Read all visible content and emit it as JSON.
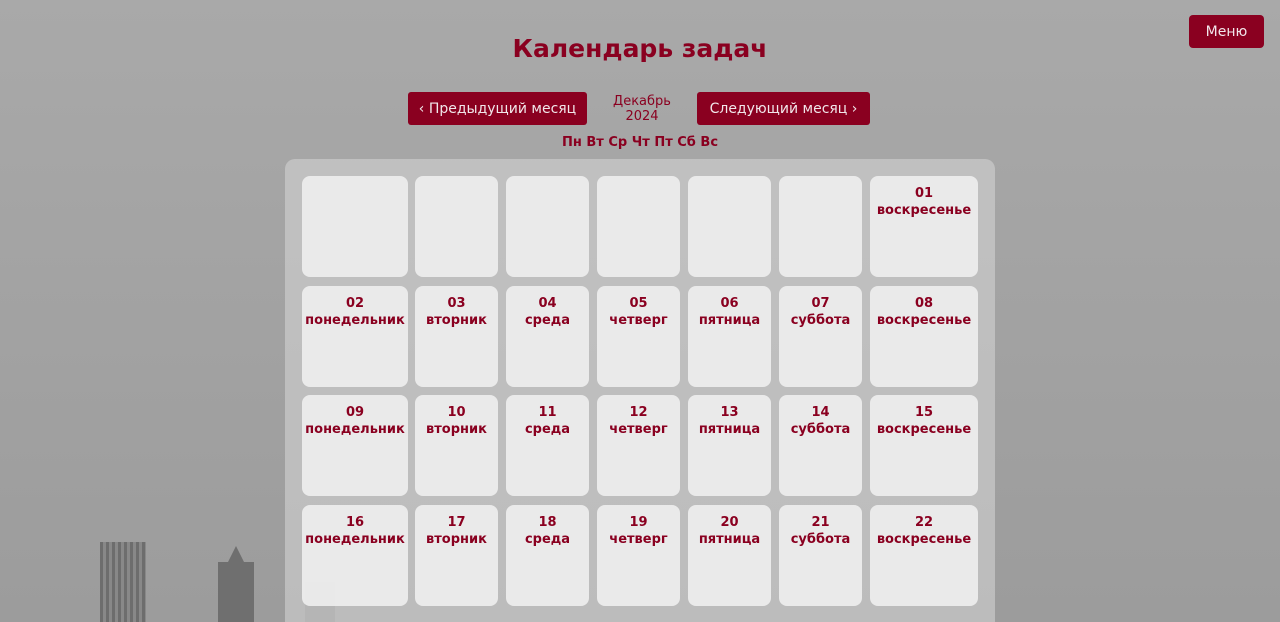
{
  "header": {
    "title": "Календарь задач",
    "menu_label": "Меню"
  },
  "nav": {
    "prev_label": "‹ Предыдущий месяц",
    "current_month": "Декабрь 2024",
    "next_label": "Следующий месяц ›"
  },
  "weekdays": [
    "Пн",
    "Вт",
    "Ср",
    "Чт",
    "Пт",
    "Сб",
    "Вс"
  ],
  "weeks": [
    [
      {
        "num": "",
        "day": ""
      },
      {
        "num": "",
        "day": ""
      },
      {
        "num": "",
        "day": ""
      },
      {
        "num": "",
        "day": ""
      },
      {
        "num": "",
        "day": ""
      },
      {
        "num": "",
        "day": ""
      },
      {
        "num": "01",
        "day": "воскресенье"
      }
    ],
    [
      {
        "num": "02",
        "day": "понедельник"
      },
      {
        "num": "03",
        "day": "вторник"
      },
      {
        "num": "04",
        "day": "среда"
      },
      {
        "num": "05",
        "day": "четверг"
      },
      {
        "num": "06",
        "day": "пятница"
      },
      {
        "num": "07",
        "day": "суббота"
      },
      {
        "num": "08",
        "day": "воскресенье"
      }
    ],
    [
      {
        "num": "09",
        "day": "понедельник"
      },
      {
        "num": "10",
        "day": "вторник"
      },
      {
        "num": "11",
        "day": "среда"
      },
      {
        "num": "12",
        "day": "четверг"
      },
      {
        "num": "13",
        "day": "пятница"
      },
      {
        "num": "14",
        "day": "суббота"
      },
      {
        "num": "15",
        "day": "воскресенье"
      }
    ],
    [
      {
        "num": "16",
        "day": "понедельник"
      },
      {
        "num": "17",
        "day": "вторник"
      },
      {
        "num": "18",
        "day": "среда"
      },
      {
        "num": "19",
        "day": "четверг"
      },
      {
        "num": "20",
        "day": "пятница"
      },
      {
        "num": "21",
        "day": "суббота"
      },
      {
        "num": "22",
        "day": "воскресенье"
      }
    ]
  ],
  "colors": {
    "accent": "#8a0020",
    "button_text": "#f1e6ea",
    "cell_bg": "#ececec"
  }
}
